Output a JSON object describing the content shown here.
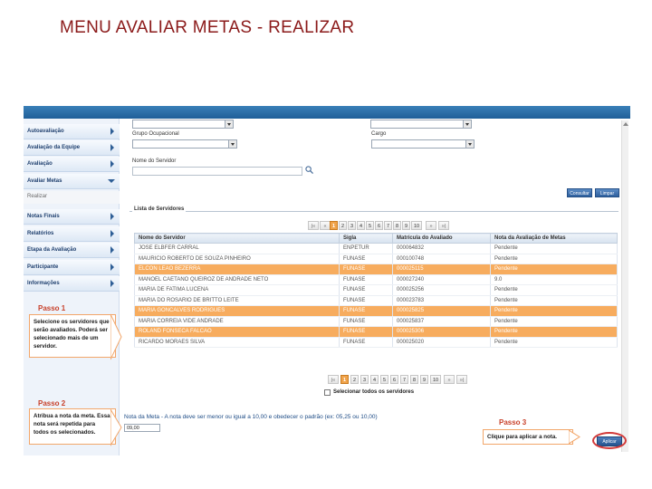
{
  "slide": {
    "title": "MENU AVALIAR  METAS - REALIZAR"
  },
  "sidebar": {
    "items": [
      {
        "label": "Autoavaliação"
      },
      {
        "label": "Avaliação da Equipe"
      },
      {
        "label": "Avaliação"
      },
      {
        "label": "Avaliar Metas"
      }
    ],
    "sub_item": "Realizar",
    "items_after": [
      {
        "label": "Notas Finais"
      },
      {
        "label": "Relatórios"
      },
      {
        "label": "Etapa da Avaliação"
      },
      {
        "label": "Participante"
      },
      {
        "label": "Informações"
      }
    ]
  },
  "steps": {
    "step1": {
      "title": "Passo 1",
      "text": "Selecione os servidores que serão avaliados. Poderá ser selecionado mais de um servidor."
    },
    "step2": {
      "title": "Passo 2",
      "text": "Atribua a nota da meta. Essa nota será repetida para todos os selecionados."
    },
    "step3": {
      "title": "Passo 3",
      "text": "Clique para aplicar a nota."
    }
  },
  "form": {
    "grupo_label": "Grupo Ocupacional",
    "cargo_label": "Cargo",
    "nome_label": "Nome do Servidor",
    "consultar_button": "Consultar",
    "limpar_button": "Limpar",
    "fieldset_legend": "Lista de Servidores"
  },
  "pager": {
    "pages": [
      "1",
      "2",
      "3",
      "4",
      "5",
      "6",
      "7",
      "8",
      "9",
      "10"
    ],
    "active": "1",
    "next": "»",
    "last": "»|"
  },
  "table": {
    "headers": [
      "Nome do Servidor",
      "Sigla",
      "Matrícula do Avaliado",
      "Nota da Avaliação de Metas"
    ],
    "rows": [
      {
        "name": "JOSE ELBFER CARRAL",
        "sigla": "ENPETUR",
        "matricula": "000064832",
        "nota": "Pendente",
        "selected": false
      },
      {
        "name": "MAURICIO ROBERTO DE SOUZA PINHEIRO",
        "sigla": "FUNASE",
        "matricula": "000100748",
        "nota": "Pendente",
        "selected": false
      },
      {
        "name": "ELCON LEAO BEZERRA",
        "sigla": "FUNASE",
        "matricula": "000025115",
        "nota": "Pendente",
        "selected": true
      },
      {
        "name": "MANOEL CAETANO QUEIROZ DE ANDRADE NETO",
        "sigla": "FUNASE",
        "matricula": "000027240",
        "nota": "9.0",
        "selected": false
      },
      {
        "name": "MARIA DE FATIMA LUCENA",
        "sigla": "FUNASE",
        "matricula": "000025256",
        "nota": "Pendente",
        "selected": false
      },
      {
        "name": "MARIA DO ROSARIO DE BRITTO LEITE",
        "sigla": "FUNASE",
        "matricula": "000023783",
        "nota": "Pendente",
        "selected": false
      },
      {
        "name": "MARIA GONCALVES RODRIGUES",
        "sigla": "FUNASE",
        "matricula": "000025825",
        "nota": "Pendente",
        "selected": true
      },
      {
        "name": "MARIA CORREIA VIDE ANDRADE",
        "sigla": "FUNASE",
        "matricula": "000025837",
        "nota": "Pendente",
        "selected": false
      },
      {
        "name": "ROLAND FONSECA FALCAO",
        "sigla": "FUNASE",
        "matricula": "000025306",
        "nota": "Pendente",
        "selected": true
      },
      {
        "name": "RICARDO MORAES SILVA",
        "sigla": "FUNASE",
        "matricula": "000025020",
        "nota": "Pendente",
        "selected": false
      }
    ]
  },
  "select_all_label": "Selecionar todos os servidores",
  "nota": {
    "label": "Nota da Meta - A nota deve ser menor ou igual a 10,00 e obedecer o padrão (ex: 05,25 ou 10,00)",
    "value": "09,00"
  },
  "apply_button": "Aplicar",
  "colors": {
    "title": "#8b1a1a",
    "highlight": "#f7ac5e",
    "step_title": "#c8412b",
    "apply_ring": "#d23a3a"
  }
}
